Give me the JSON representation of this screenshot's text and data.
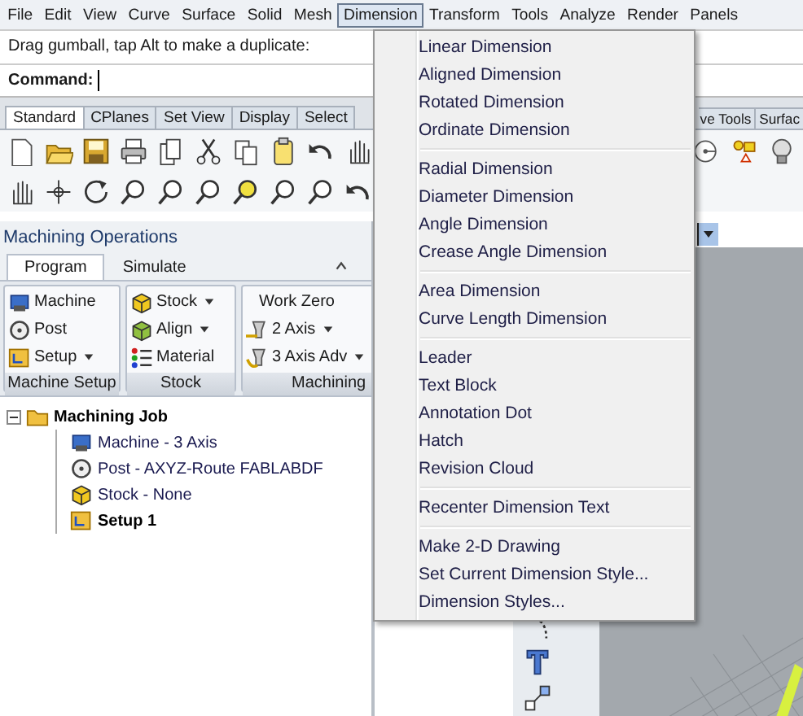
{
  "menubar": [
    {
      "label": "File",
      "selected": false
    },
    {
      "label": "Edit",
      "selected": false
    },
    {
      "label": "View",
      "selected": false
    },
    {
      "label": "Curve",
      "selected": false
    },
    {
      "label": "Surface",
      "selected": false
    },
    {
      "label": "Solid",
      "selected": false
    },
    {
      "label": "Mesh",
      "selected": false
    },
    {
      "label": "Dimension",
      "selected": true
    },
    {
      "label": "Transform",
      "selected": false
    },
    {
      "label": "Tools",
      "selected": false
    },
    {
      "label": "Analyze",
      "selected": false
    },
    {
      "label": "Render",
      "selected": false
    },
    {
      "label": "Panels",
      "selected": false
    }
  ],
  "command": {
    "message": "Drag gumball, tap Alt to make a duplicate:",
    "prompt": "Command:"
  },
  "toolbar_tabs": {
    "left": [
      {
        "label": "Standard",
        "selected": true
      },
      {
        "label": "CPlanes",
        "selected": false
      },
      {
        "label": "Set View",
        "selected": false
      },
      {
        "label": "Display",
        "selected": false
      },
      {
        "label": "Select",
        "selected": false
      }
    ],
    "right": [
      {
        "label": "ve Tools",
        "selected": false
      },
      {
        "label": "Surfac",
        "selected": false
      }
    ]
  },
  "machining_panel": {
    "title": "Machining Operations",
    "tabs": [
      {
        "label": "Program",
        "selected": true
      },
      {
        "label": "Simulate",
        "selected": false
      }
    ],
    "groups": [
      {
        "label": "Machine Setup",
        "items": [
          {
            "label": "Machine",
            "dropdown": false
          },
          {
            "label": "Post",
            "dropdown": false
          },
          {
            "label": "Setup",
            "dropdown": true
          }
        ]
      },
      {
        "label": "Stock",
        "items": [
          {
            "label": "Stock",
            "dropdown": true
          },
          {
            "label": "Align",
            "dropdown": true
          },
          {
            "label": "Material",
            "dropdown": false
          }
        ]
      },
      {
        "label": "Machining",
        "items": [
          {
            "label": "Work Zero",
            "dropdown": false
          },
          {
            "label": "2 Axis",
            "dropdown": true
          },
          {
            "label": "3 Axis Adv",
            "dropdown": true
          }
        ]
      }
    ],
    "tree": {
      "label": "Machining Job",
      "bold": true,
      "expanded": true,
      "children": [
        {
          "label": "Machine - 3 Axis",
          "bold": false
        },
        {
          "label": "Post - AXYZ-Route FABLABDF",
          "bold": false
        },
        {
          "label": "Stock - None",
          "bold": false
        },
        {
          "label": "Setup 1",
          "bold": true
        }
      ]
    }
  },
  "dimension_menu": {
    "sections": [
      [
        "Linear Dimension",
        "Aligned Dimension",
        "Rotated Dimension",
        "Ordinate Dimension"
      ],
      [
        "Radial Dimension",
        "Diameter Dimension",
        "Angle Dimension",
        "Crease Angle Dimension"
      ],
      [
        "Area Dimension",
        "Curve Length Dimension"
      ],
      [
        "Leader",
        "Text Block",
        "Annotation Dot",
        "Hatch",
        "Revision Cloud"
      ],
      [
        "Recenter Dimension Text"
      ],
      [
        "Make 2-D Drawing",
        "Set Current Dimension Style...",
        "Dimension Styles..."
      ]
    ]
  }
}
